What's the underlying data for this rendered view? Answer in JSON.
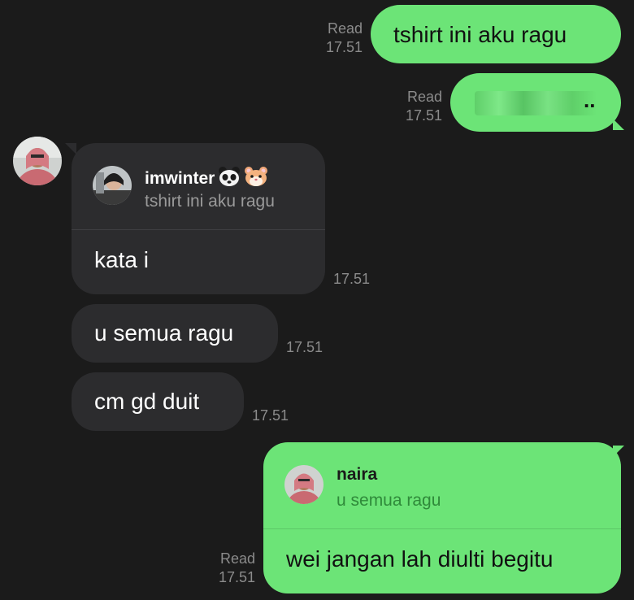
{
  "messages": [
    {
      "id": "m1",
      "direction": "outgoing",
      "text": "tshirt ini aku ragu",
      "status": "Read",
      "time": "17.51"
    },
    {
      "id": "m2",
      "direction": "outgoing",
      "text": "",
      "redacted": true,
      "status": "Read",
      "time": "17.51"
    },
    {
      "id": "m3",
      "direction": "incoming",
      "reply_to": {
        "name": "imwinter",
        "name_emojis": [
          "panda-emoji",
          "hamster-emoji"
        ],
        "text": "tshirt ini aku ragu"
      },
      "text": "kata i",
      "time": "17.51"
    },
    {
      "id": "m4",
      "direction": "incoming",
      "text": "u semua ragu",
      "time": "17.51"
    },
    {
      "id": "m5",
      "direction": "incoming",
      "text": "cm gd duit",
      "time": "17.51"
    },
    {
      "id": "m6",
      "direction": "outgoing",
      "reply_to": {
        "name": "naira",
        "text": "u semua ragu"
      },
      "text": "wei jangan lah diulti begitu",
      "status": "Read",
      "time": "17.51"
    }
  ],
  "colors": {
    "background": "#1b1b1b",
    "outgoing_bubble": "#6ce477",
    "incoming_bubble": "#2c2c2e",
    "meta_text": "#8b8b8b"
  }
}
